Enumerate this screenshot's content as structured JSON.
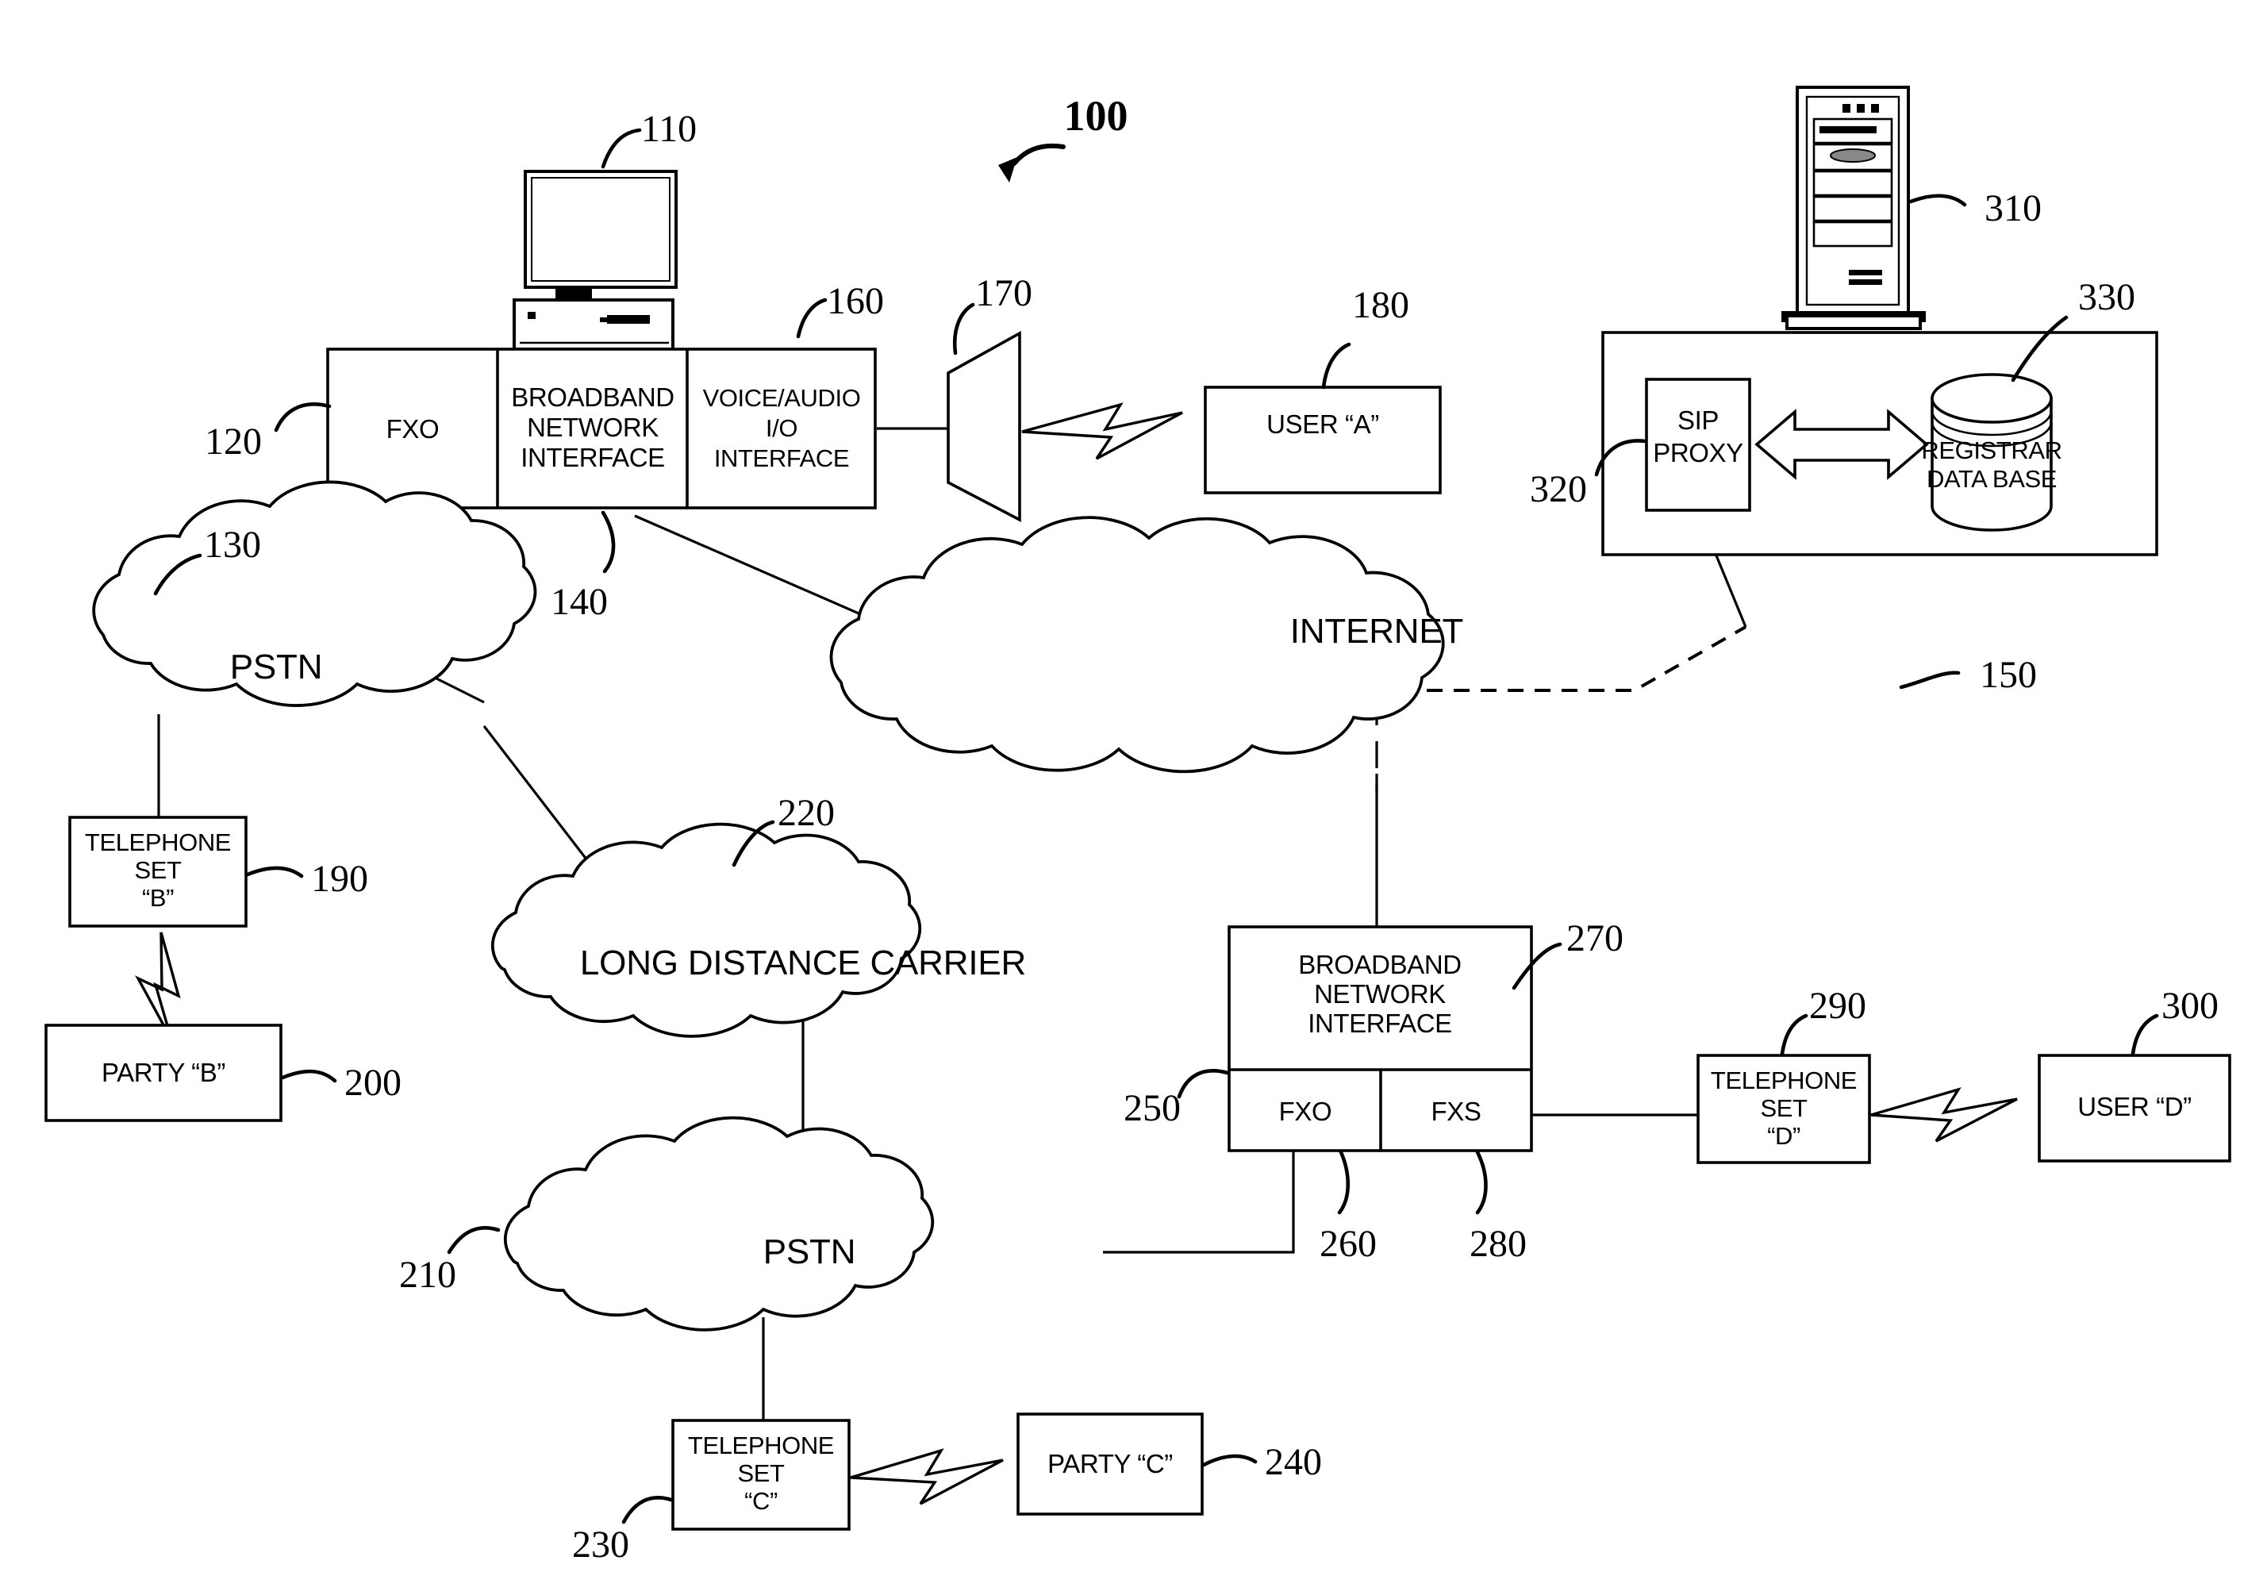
{
  "figure": {
    "number": "100",
    "title_ref": "100"
  },
  "nodes": {
    "computer": {
      "ref": "110",
      "name": "desktop-computer"
    },
    "fxo_local": {
      "ref": "120",
      "label": "FXO"
    },
    "pstn_top": {
      "ref": "130",
      "label": "PSTN"
    },
    "broadband_local": {
      "ref": "140",
      "label_line1": "BROADBAND",
      "label_line2": "NETWORK",
      "label_line3": "INTERFACE"
    },
    "internet": {
      "ref": "150",
      "label": "INTERNET"
    },
    "voice_audio": {
      "ref": "160",
      "label_line1": "VOICE/AUDIO",
      "label_line2": "I/O",
      "label_line3": "INTERFACE"
    },
    "speaker": {
      "ref": "170",
      "name": "speaker-transducer"
    },
    "user_a": {
      "ref": "180",
      "label": "USER “A”"
    },
    "telephone_set_b": {
      "ref": "190",
      "label_line1": "TELEPHONE",
      "label_line2": "SET",
      "label_line3": "“B”"
    },
    "party_b": {
      "ref": "200",
      "label": "PARTY “B”"
    },
    "pstn_bottom": {
      "ref": "210",
      "label": "PSTN"
    },
    "long_distance_carrier": {
      "ref": "220",
      "label": "LONG DISTANCE CARRIER"
    },
    "telephone_set_c": {
      "ref": "230",
      "label_line1": "TELEPHONE",
      "label_line2": "SET",
      "label_line3": "“C”"
    },
    "party_c": {
      "ref": "240",
      "label": "PARTY “C”"
    },
    "fxo_remote": {
      "ref": "250",
      "label": "FXO"
    },
    "fxo_remote_lead": {
      "ref": "260"
    },
    "broadband_remote": {
      "ref": "270",
      "label_line1": "BROADBAND",
      "label_line2": "NETWORK",
      "label_line3": "INTERFACE"
    },
    "fxs_remote": {
      "ref": "280",
      "label": "FXS"
    },
    "telephone_set_d": {
      "ref": "290",
      "label_line1": "TELEPHONE",
      "label_line2": "SET",
      "label_line3": "“D”"
    },
    "user_d": {
      "ref": "300",
      "label": "USER “D”"
    },
    "server": {
      "ref": "310",
      "name": "server-tower"
    },
    "sip_proxy": {
      "ref": "320",
      "label_line1": "SIP",
      "label_line2": "PROXY"
    },
    "registrar_db": {
      "ref": "330",
      "label_line1": "REGISTRAR",
      "label_line2": "DATA BASE"
    }
  },
  "colors": {
    "stroke": "#000000",
    "fill": "#ffffff"
  }
}
